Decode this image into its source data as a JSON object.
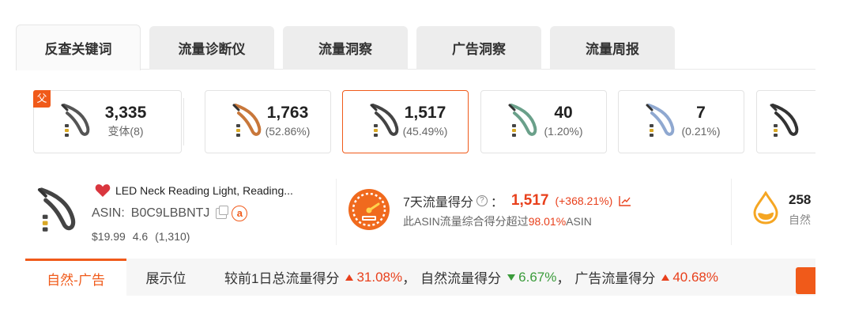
{
  "tabs": [
    {
      "label": "反查关键词",
      "active": true
    },
    {
      "label": "流量诊断仪",
      "active": false
    },
    {
      "label": "流量洞察",
      "active": false
    },
    {
      "label": "广告洞察",
      "active": false
    },
    {
      "label": "流量周报",
      "active": false
    }
  ],
  "variants": {
    "parent_badge": "父",
    "items": [
      {
        "value": "3,335",
        "sub": "变体(8)",
        "color": "#555555"
      },
      {
        "value": "1,763",
        "sub": "(52.86%)",
        "color": "#c8773a"
      },
      {
        "value": "1,517",
        "sub": "(45.49%)",
        "color": "#444444",
        "selected": true
      },
      {
        "value": "40",
        "sub": "(1.20%)",
        "color": "#6aa08a"
      },
      {
        "value": "7",
        "sub": "(0.21%)",
        "color": "#8fa8d0"
      },
      {
        "value": "",
        "sub": "",
        "color": "#333333"
      }
    ]
  },
  "product": {
    "title": "LED Neck Reading Light, Reading...",
    "asin_label": "ASIN:",
    "asin": "B0C9LBBNTJ",
    "amazon_glyph": "a",
    "price": "$19.99",
    "rating": "4.6",
    "reviews": "(1,310)"
  },
  "score": {
    "label": "7天流量得分",
    "help_glyph": "?",
    "colon": "：",
    "value": "1,517",
    "change": "(+368.21%)",
    "desc_prefix": "此ASIN流量综合得分超过",
    "desc_highlight": "98.01%",
    "desc_suffix": "ASIN"
  },
  "right_partial": {
    "value": "258",
    "sub": "自然"
  },
  "bottom": {
    "tab_active": "自然-广告",
    "tab_other": "展示位",
    "compare": {
      "total_label": "较前1日总流量得分",
      "total_change": "31.08%",
      "sep1": "，",
      "natural_label": "自然流量得分",
      "natural_change": "6.67%",
      "sep2": "，",
      "ad_label": "广告流量得分",
      "ad_change": "40.68%"
    }
  },
  "colors": {
    "accent": "#f05a1a",
    "up": "#e8401c",
    "down": "#3a9b3a"
  }
}
